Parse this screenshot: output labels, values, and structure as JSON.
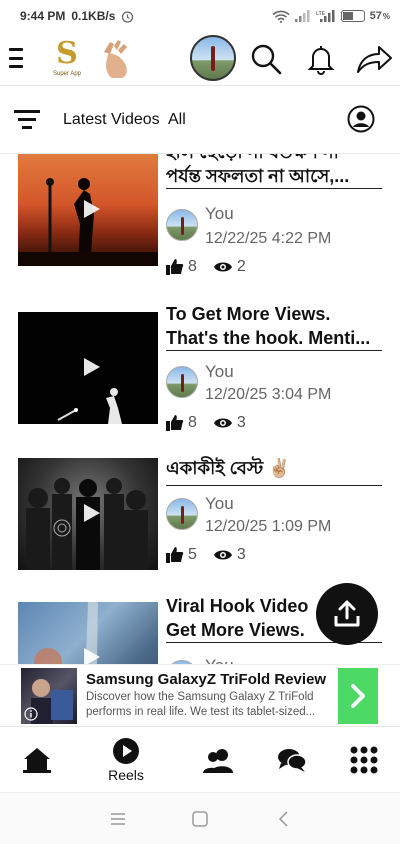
{
  "status_bar": {
    "time": "9:44 PM",
    "speed": "0.1KB/s",
    "battery": "57",
    "battery_unit": "%",
    "battery_level": 0.57
  },
  "header": {
    "logo_letter": "S",
    "logo_text": "Super App",
    "icons": [
      "hamburger-icon",
      "hand-icon",
      "profile-avatar",
      "search-icon",
      "bell-icon",
      "share-icon"
    ]
  },
  "filter_bar": {
    "latest_label": "Latest Videos",
    "all_label": "All"
  },
  "feed": [
    {
      "title_line1": "হাল ছেড়ো না যতক্ষণ না",
      "title_line2": "পর্যন্ত সফলতা না আসে,...",
      "author": "You",
      "date": "12/22/25 4:22 PM",
      "likes": "8",
      "views": "2"
    },
    {
      "title_line1": "To Get More Views.",
      "title_line2": "That's the hook. Menti...",
      "author": "You",
      "date": "12/20/25 3:04 PM",
      "likes": "8",
      "views": "3"
    },
    {
      "title_line1": "একাকীই বেস্ট ✌🏼",
      "title_line2": "",
      "author": "You",
      "date": "12/20/25 1:09 PM",
      "likes": "5",
      "views": "3"
    },
    {
      "title_line1": "Viral Hook Video",
      "title_line2": "Get More Views.",
      "author": "You",
      "date": "",
      "likes": "",
      "views": ""
    }
  ],
  "ad": {
    "title": "Samsung GalaxyZ TriFold Review",
    "description": "Discover how the Samsung Galaxy Z TriFold performs in real life. We test its tablet-sized..."
  },
  "bottom_nav": {
    "reels_label": "Reels"
  },
  "colors": {
    "accent": "#111111",
    "ad_cta": "#4cd964",
    "logo_gold": "#c69b2a"
  }
}
